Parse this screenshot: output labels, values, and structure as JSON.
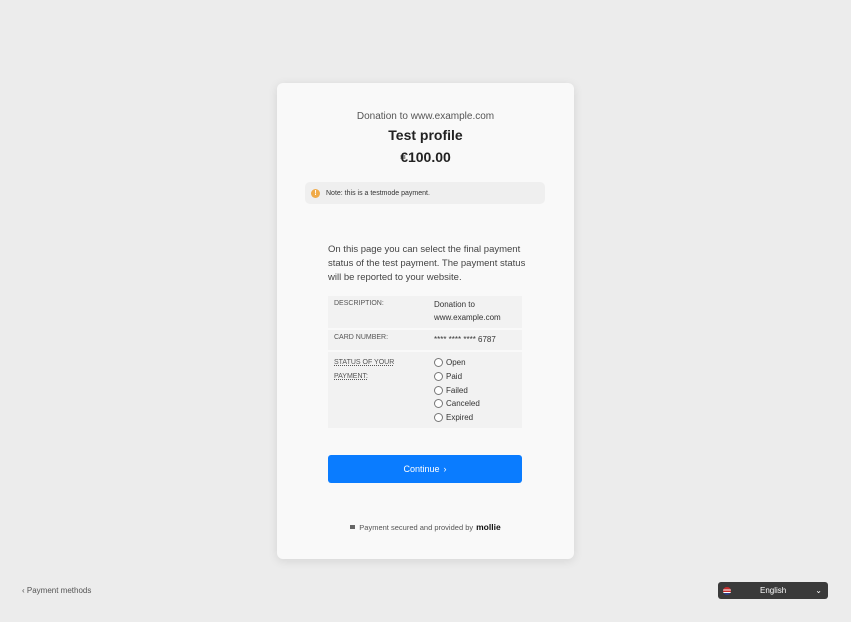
{
  "header": {
    "subtitle": "Donation to www.example.com",
    "title": "Test profile",
    "amount": "€100.00"
  },
  "note": {
    "icon": "info-icon",
    "text": "Note: this is a testmode payment."
  },
  "intro": "On this page you can select the final payment status of the test payment. The payment status will be reported to your website.",
  "details": {
    "description_label": "DESCRIPTION:",
    "description_value": "Donation to www.example.com",
    "card_label": "CARD NUMBER:",
    "card_value": "**** **** **** 6787",
    "status_label": "STATUS OF YOUR PAYMENT:",
    "status_options": [
      "Open",
      "Paid",
      "Failed",
      "Canceled",
      "Expired"
    ]
  },
  "continue_button": {
    "label": "Continue",
    "chevron": "›"
  },
  "footer": {
    "text": "Payment secured and provided by",
    "brand": "mollie"
  },
  "back_link": "‹ Payment methods",
  "language": {
    "label": "English",
    "chevron": "⌄",
    "accent": "#3a3a3a"
  },
  "colors": {
    "primary": "#0a7cff",
    "note_icon": "#f0ab4a",
    "background": "#ececec"
  }
}
